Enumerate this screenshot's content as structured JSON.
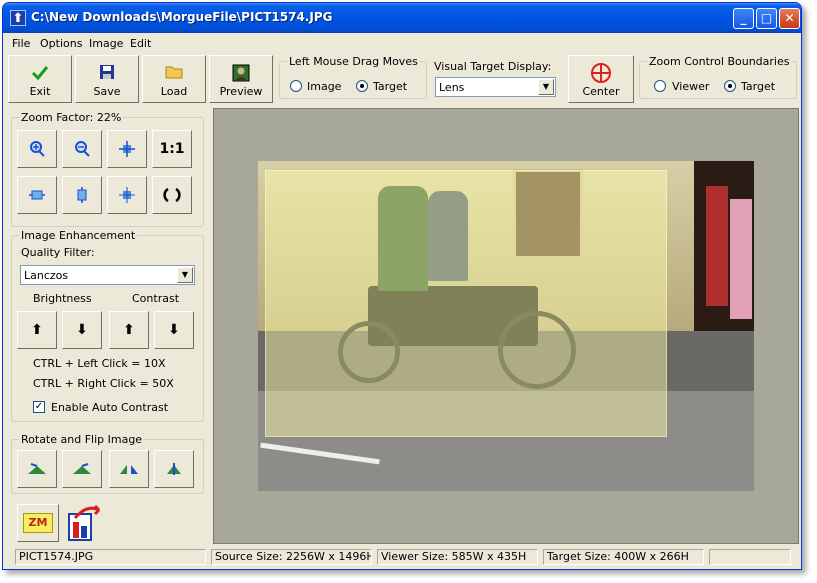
{
  "window": {
    "title": "C:\\New Downloads\\MorgueFile\\PICT1574.JPG"
  },
  "menu": [
    "File",
    "Options",
    "Image",
    "Edit"
  ],
  "toolbar": {
    "exit": "Exit",
    "save": "Save",
    "load": "Load",
    "preview": "Preview",
    "center": "Center"
  },
  "drag_group": {
    "legend": "Left Mouse Drag Moves",
    "opt_image": "Image",
    "opt_target": "Target",
    "selected": "Target"
  },
  "visual_target": {
    "label": "Visual Target Display:",
    "value": "Lens"
  },
  "zoom_bounds": {
    "legend": "Zoom Control Boundaries",
    "opt_viewer": "Viewer",
    "opt_target": "Target",
    "selected": "Target"
  },
  "zoom": {
    "legend": "Zoom Factor: 22%",
    "one_to_one": "1:1"
  },
  "enhance": {
    "legend": "Image Enhancement",
    "quality_label": "Quality Filter:",
    "quality_value": "Lanczos",
    "brightness": "Brightness",
    "contrast": "Contrast",
    "hint1": "CTRL + Left Click = 10X",
    "hint2": "CTRL + Right Click = 50X",
    "auto_contrast": "Enable Auto Contrast",
    "auto_contrast_checked": true
  },
  "rotate": {
    "legend": "Rotate and Flip Image"
  },
  "logo": {
    "zm": "ZM"
  },
  "status": {
    "file": "PICT1574.JPG",
    "source": "Source Size: 2256W x 1496H",
    "viewer": "Viewer Size: 585W x 435H",
    "target": "Target Size: 400W x 266H",
    "extra": ""
  },
  "colors": {
    "title_blue": "#0054e3",
    "lens_yellow": "#ffffaa",
    "viewer_bg": "#a8a89a"
  }
}
